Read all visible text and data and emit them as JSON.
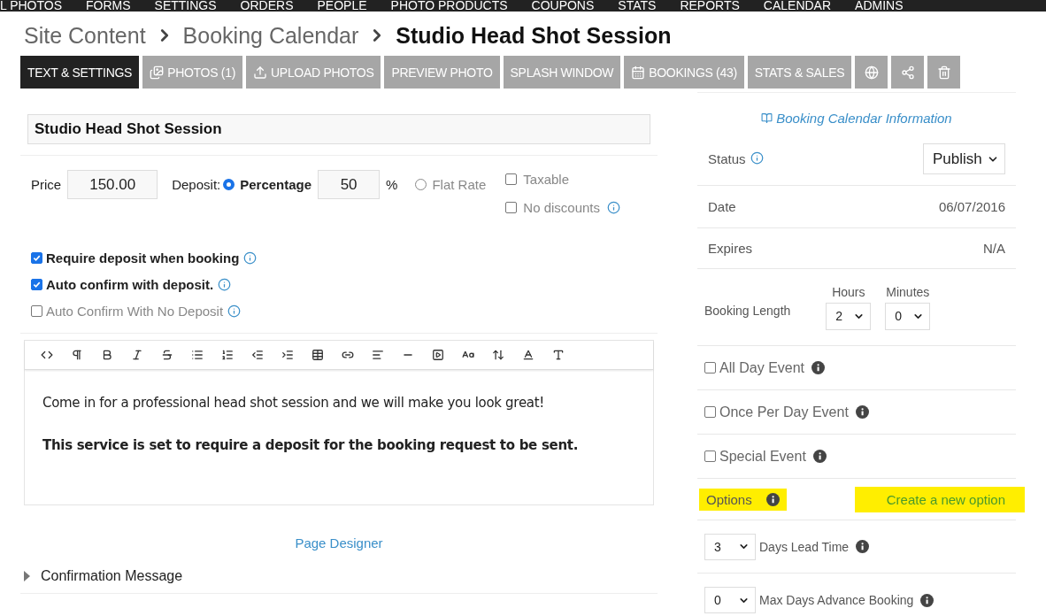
{
  "top_nav": [
    "L PHOTOS",
    "FORMS",
    "SETTINGS",
    "ORDERS",
    "PEOPLE",
    "PHOTO PRODUCTS",
    "COUPONS",
    "STATS",
    "REPORTS",
    "CALENDAR",
    "ADMINS"
  ],
  "breadcrumb": {
    "items": [
      "Site Content",
      "Booking Calendar"
    ],
    "current": "Studio Head Shot Session"
  },
  "tabs": [
    {
      "label": "TEXT & SETTINGS",
      "selected": true
    },
    {
      "label": "PHOTOS (1)",
      "selected": false
    },
    {
      "label": "UPLOAD PHOTOS",
      "selected": false
    },
    {
      "label": "PREVIEW PHOTO",
      "selected": false
    },
    {
      "label": "SPLASH WINDOW",
      "selected": false
    },
    {
      "label": "BOOKINGS (43)",
      "selected": false
    },
    {
      "label": "STATS & SALES",
      "selected": false
    }
  ],
  "title_field": {
    "value": "Studio Head Shot Session"
  },
  "price": {
    "label": "Price",
    "value": "150.00"
  },
  "deposit": {
    "label": "Deposit:",
    "options": [
      {
        "label": "Percentage",
        "selected": true
      },
      {
        "label": "Flat Rate",
        "selected": false
      }
    ],
    "value": "50",
    "unit": "%"
  },
  "side_checks": [
    {
      "label": "Taxable",
      "checked": false,
      "info": false
    },
    {
      "label": "No discounts",
      "checked": false,
      "info": true
    }
  ],
  "checks": [
    {
      "label": "Require deposit when booking",
      "checked": true
    },
    {
      "label": "Auto confirm with deposit.",
      "checked": true
    },
    {
      "label": "Auto Confirm With No Deposit",
      "checked": false
    }
  ],
  "editor": {
    "paragraphs": [
      {
        "text": "Come in for a professional head shot session and we will make you look great!",
        "bold": false
      },
      {
        "text": "This service is set to require a deposit for the booking request to be sent.",
        "bold": true
      }
    ]
  },
  "page_designer": "Page Designer",
  "confirmation": {
    "label": "Confirmation Message",
    "expanded": false
  },
  "info_link": "Booking Calendar Information",
  "status": {
    "label": "Status",
    "value": "Publish"
  },
  "date": {
    "label": "Date",
    "value": "06/07/2016"
  },
  "expires": {
    "label": "Expires",
    "value": "N/A"
  },
  "booking_length": {
    "label": "Booking Length",
    "hours_label": "Hours",
    "hours": "2",
    "minutes_label": "Minutes",
    "minutes": "0"
  },
  "events": [
    {
      "label": "All Day Event",
      "checked": false
    },
    {
      "label": "Once Per Day Event",
      "checked": false
    },
    {
      "label": "Special Event",
      "checked": false
    }
  ],
  "options": {
    "label": "Options",
    "highlighted": true,
    "create_link": "Create a new option",
    "create_highlighted": true
  },
  "lead_time": {
    "value": "3",
    "label": "Days Lead Time"
  },
  "max_advance": {
    "value": "0",
    "label": "Max Days Advance Booking"
  }
}
